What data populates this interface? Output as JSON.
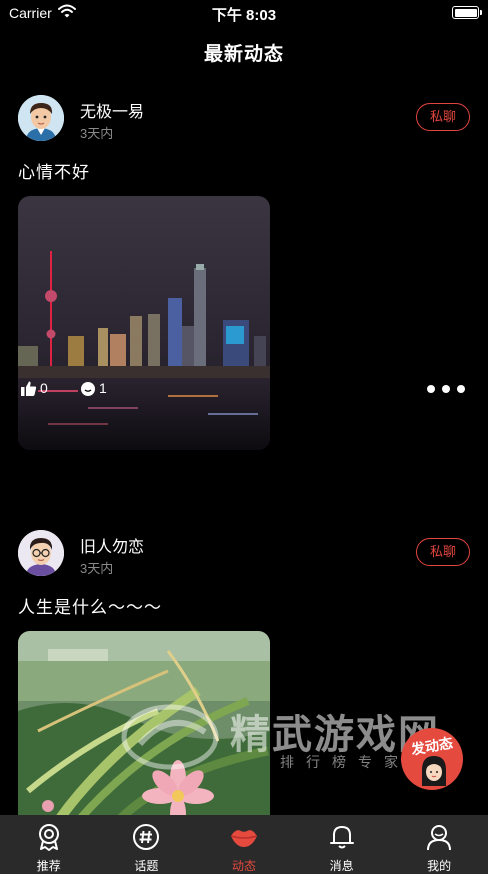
{
  "status_bar": {
    "carrier": "Carrier",
    "time": "下午 8:03"
  },
  "header": {
    "title": "最新动态"
  },
  "posts": [
    {
      "username": "无极一易",
      "time": "3天内",
      "chat_label": "私聊",
      "text": "心情不好",
      "likes": "0",
      "comments": "1"
    },
    {
      "username": "旧人勿恋",
      "time": "3天内",
      "chat_label": "私聊",
      "text": "人生是什么～～～"
    }
  ],
  "fab": {
    "label": "发动态"
  },
  "watermark": {
    "title": "精武游戏网",
    "subtitle": "排行榜专家"
  },
  "tabs": [
    {
      "label": "推荐",
      "icon": "badge-icon"
    },
    {
      "label": "话题",
      "icon": "hashtag-icon"
    },
    {
      "label": "动态",
      "icon": "lips-icon"
    },
    {
      "label": "消息",
      "icon": "bell-icon"
    },
    {
      "label": "我的",
      "icon": "person-icon"
    }
  ],
  "colors": {
    "accent": "#e54a3f",
    "tab_bar": "#2a2a2a",
    "background": "#000000",
    "muted_text": "#8a8a8a"
  }
}
